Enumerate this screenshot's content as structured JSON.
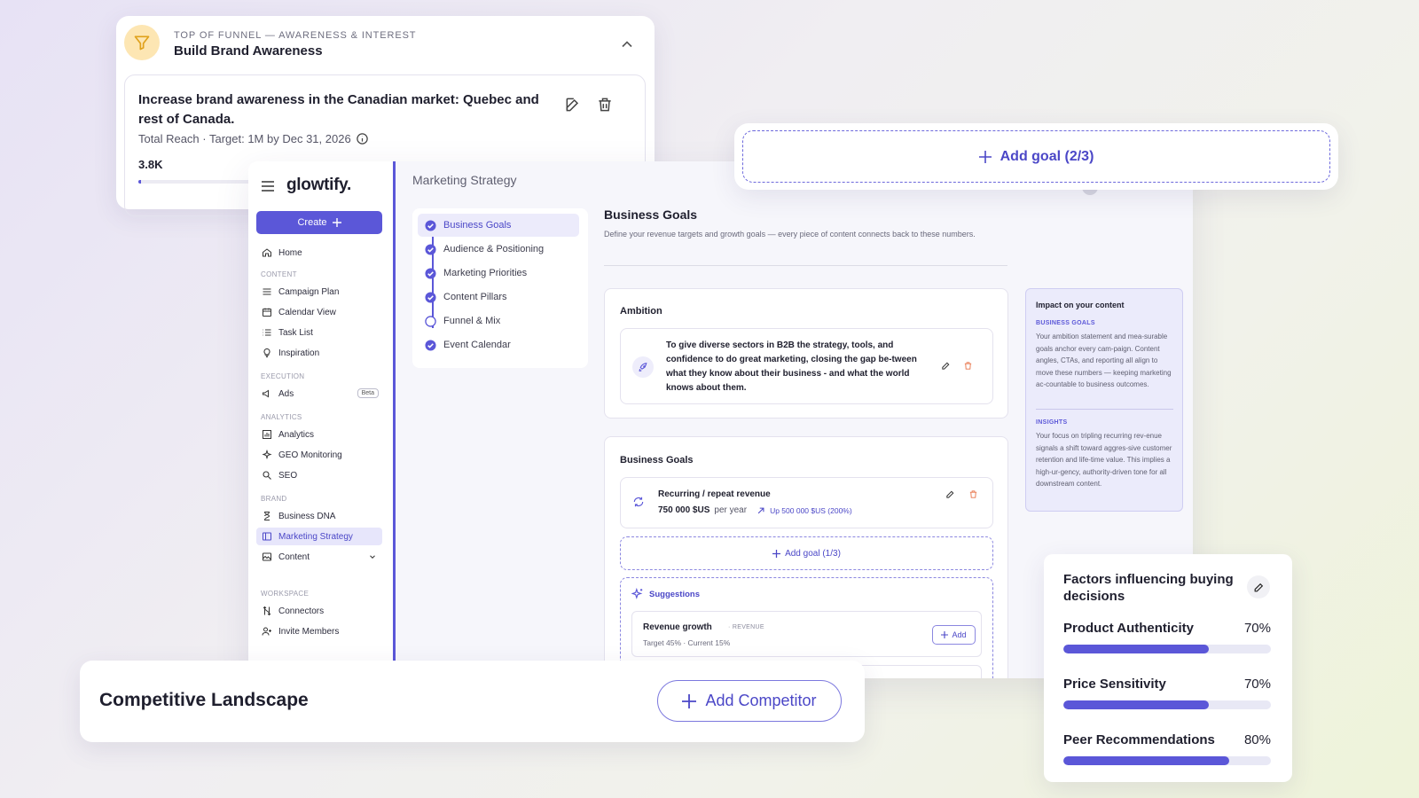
{
  "funnel_card": {
    "eyebrow": "TOP OF FUNNEL — AWARENESS & INTEREST",
    "title": "Build Brand Awareness",
    "goal_text": "Increase brand awareness in the Canadian market: Quebec and rest of Canada.",
    "goal_sub": "Total Reach · Target: 1M by Dec 31, 2026",
    "current_value": "3.8K",
    "progress_fraction": 0.0038
  },
  "app": {
    "logo": "glowtify.",
    "create_label": "Create",
    "page_heading": "Marketing Strategy",
    "nav": {
      "home": "Home",
      "section_content": "CONTENT",
      "campaign_plan": "Campaign Plan",
      "calendar_view": "Calendar View",
      "task_list": "Task List",
      "inspiration": "Inspiration",
      "section_execution": "EXECUTION",
      "ads": "Ads",
      "beta": "Beta",
      "section_analytics": "ANALYTICS",
      "analytics": "Analytics",
      "geo_monitoring": "GEO Monitoring",
      "seo": "SEO",
      "section_brand": "BRAND",
      "business_dna": "Business DNA",
      "marketing_strategy": "Marketing Strategy",
      "content": "Content",
      "section_workspace": "WORKSPACE",
      "connectors": "Connectors",
      "invite_members": "Invite Members"
    },
    "steps": [
      {
        "label": "Business Goals",
        "done": true
      },
      {
        "label": "Audience & Positioning",
        "done": true
      },
      {
        "label": "Marketing Priorities",
        "done": true
      },
      {
        "label": "Content Pillars",
        "done": true
      },
      {
        "label": "Funnel & Mix",
        "done": false
      },
      {
        "label": "Event Calendar",
        "done": true
      }
    ],
    "business_goals": {
      "title": "Business Goals",
      "description": "Define your revenue targets and growth goals — every piece of content connects back to these numbers.",
      "ambition_title": "Ambition",
      "ambition_text": "To give diverse sectors in B2B the strategy, tools, and confidence to do great marketing, closing the gap be-tween what they know about their business - and what the world knows about them.",
      "goals_title": "Business Goals",
      "goal_name": "Recurring / repeat revenue",
      "goal_value": "750 000 $US",
      "goal_per": "per year",
      "goal_delta": "Up 500 000 $US (200%)",
      "add_goal_small": "Add goal (1/3)",
      "suggestions_label": "Suggestions",
      "suggestion_name": "Revenue growth",
      "suggestion_tag": "REVENUE",
      "suggestion_detail": "Target 45% · Current 15%",
      "suggestion_add": "Add"
    },
    "impact": {
      "title": "Impact on your content",
      "label_1": "BUSINESS GOALS",
      "body_1": "Your ambition statement and mea-surable goals anchor every cam-paign. Content angles, CTAs, and reporting all align to move these numbers — keeping marketing ac-countable to business outcomes.",
      "label_2": "INSIGHTS",
      "body_2": "Your focus on tripling recurring rev-enue signals a shift toward aggres-sive customer retention and life-time value. This implies a high-ur-gency, authority-driven tone for all downstream content."
    }
  },
  "add_goal_card": {
    "label": "Add goal (2/3)"
  },
  "competitive": {
    "title": "Competitive Landscape",
    "button": "Add Competitor"
  },
  "factors": {
    "title": "Factors influencing buying decisions",
    "items": [
      {
        "name": "Product Authenticity",
        "pct_label": "70%",
        "value": 70
      },
      {
        "name": "Price Sensitivity",
        "pct_label": "70%",
        "value": 70
      },
      {
        "name": "Peer Recommendations",
        "pct_label": "80%",
        "value": 80
      }
    ]
  },
  "colors": {
    "accent": "#5b57d8",
    "accent_light": "#e7e6fb",
    "funnel_icon_bg": "#fde6b3",
    "danger": "#e8754a"
  }
}
